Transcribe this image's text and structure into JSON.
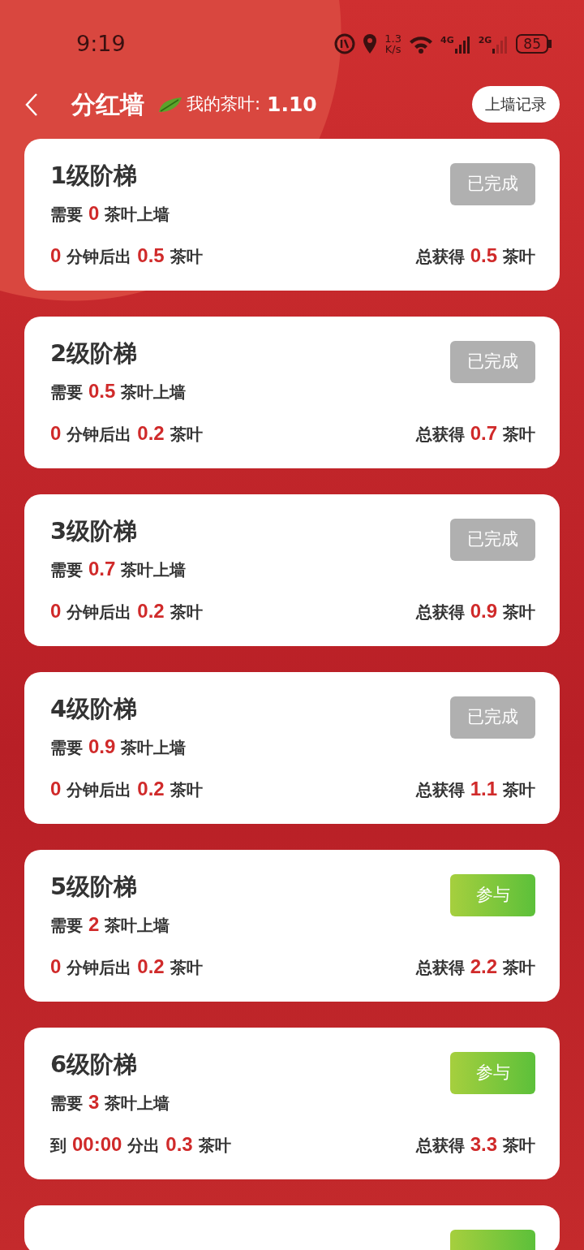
{
  "status_bar": {
    "time": "9:19",
    "speed": [
      "1.3",
      "K/s"
    ],
    "network_1": "4G",
    "network_2": "2G",
    "battery": "85"
  },
  "header": {
    "title": "分红墙",
    "balance_label": "我的茶叶:",
    "balance": "1.10",
    "record_button": "上墙记录"
  },
  "tiers": [
    {
      "title": "1级阶梯",
      "require": "需要 **0** 茶叶上墙",
      "payout": "**0** 分钟后出 **0.5** 茶叶",
      "total": "总获得 **0.5** 茶叶",
      "action": {
        "kind": "done",
        "label": "已完成"
      }
    },
    {
      "title": "2级阶梯",
      "require": "需要 **0.5** 茶叶上墙",
      "payout": "**0** 分钟后出 **0.2** 茶叶",
      "total": "总获得 **0.7** 茶叶",
      "action": {
        "kind": "done",
        "label": "已完成"
      }
    },
    {
      "title": "3级阶梯",
      "require": "需要 **0.7** 茶叶上墙",
      "payout": "**0** 分钟后出 **0.2** 茶叶",
      "total": "总获得 **0.9** 茶叶",
      "action": {
        "kind": "done",
        "label": "已完成"
      }
    },
    {
      "title": "4级阶梯",
      "require": "需要 **0.9** 茶叶上墙",
      "payout": "**0** 分钟后出 **0.2** 茶叶",
      "total": "总获得 **1.1** 茶叶",
      "action": {
        "kind": "done",
        "label": "已完成"
      }
    },
    {
      "title": "5级阶梯",
      "require": "需要 **2** 茶叶上墙",
      "payout": "**0** 分钟后出 **0.2** 茶叶",
      "total": "总获得 **2.2** 茶叶",
      "action": {
        "kind": "join",
        "label": "参与"
      }
    },
    {
      "title": "6级阶梯",
      "require": "需要 **3** 茶叶上墙",
      "payout": "到 **00:00** 分出 **0.3** 茶叶",
      "total": "总获得 **3.3** 茶叶",
      "action": {
        "kind": "join",
        "label": "参与"
      }
    },
    {
      "action": {
        "kind": "join"
      }
    }
  ]
}
